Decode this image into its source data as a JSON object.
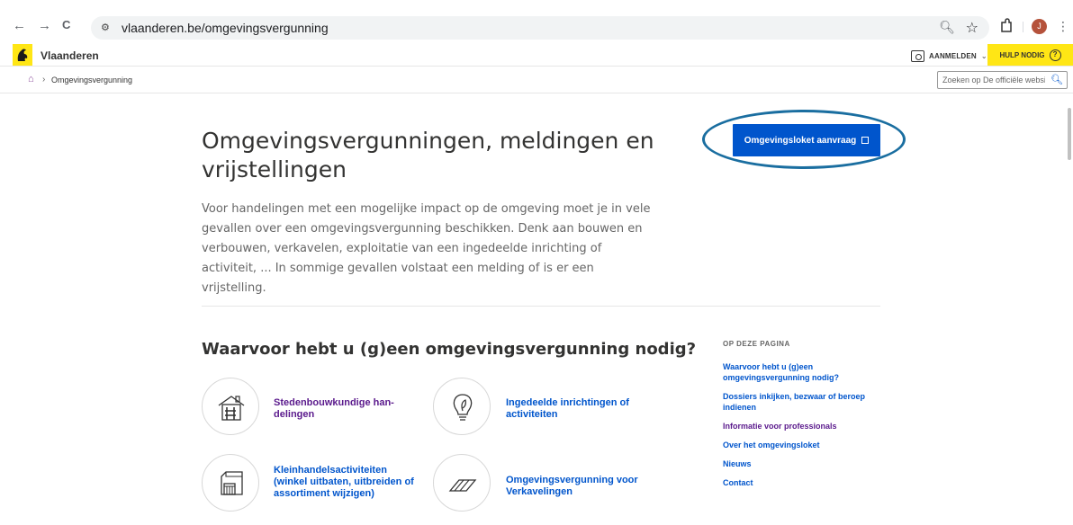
{
  "browser": {
    "back": "←",
    "forward": "→",
    "reload": "C",
    "site_info": "⚙",
    "url": "vlaanderen.be/omgevingsvergunning",
    "avatar_letter": "J"
  },
  "header": {
    "brand": "Vlaanderen",
    "login": "AANMELDEN",
    "help": "HULP NODIG",
    "brand_yellow": "#ffe615"
  },
  "breadcrumb": {
    "current": "Omgevingsvergunning",
    "search_placeholder": "Zoeken op De officiële website van Vlaanderen"
  },
  "main": {
    "title": "Omgevingsvergunningen, meldingen en vrijstellingen",
    "cta": "Omgevingsloket aanvraag",
    "intro": "Voor handelingen met een mogelijke impact op de omgeving moet je in vele gevallen over een omgevingsvergunning beschikken. Denk aan bouwen en verbouwen, verkavelen, exploitatie van een ingedeelde inrichting of activiteit, ... In sommige gevallen volstaat een melding of is er een vrijstelling.",
    "section_title": "Waarvoor hebt u (g)een omgevingsvergunning nodig?",
    "tiles": [
      {
        "label": "Stedenbouwkundige han-delingen",
        "icon": "house-scaffold-icon"
      },
      {
        "label": "Ingedeelde inrichtingen of activiteiten",
        "icon": "lightbulb-leaf-icon"
      },
      {
        "label": "Kleinhandelsactiviteiten (winkel uitbaten, uitbreiden of assortiment wijzigen)",
        "icon": "shop-icon"
      },
      {
        "label": "Omgevingsvergunning voor Verkavelingen",
        "icon": "plots-icon"
      }
    ],
    "link_color": "#05c",
    "visited_color": "#5a198c"
  },
  "toc": {
    "heading": "OP DEZE PAGINA",
    "items": [
      "Waarvoor hebt u (g)een omgevingsvergunning nodig?",
      "Dossiers inkijken, bezwaar of beroep indienen",
      "Informatie voor professionals",
      "Over het omgevingsloket",
      "Nieuws",
      "Contact"
    ]
  }
}
